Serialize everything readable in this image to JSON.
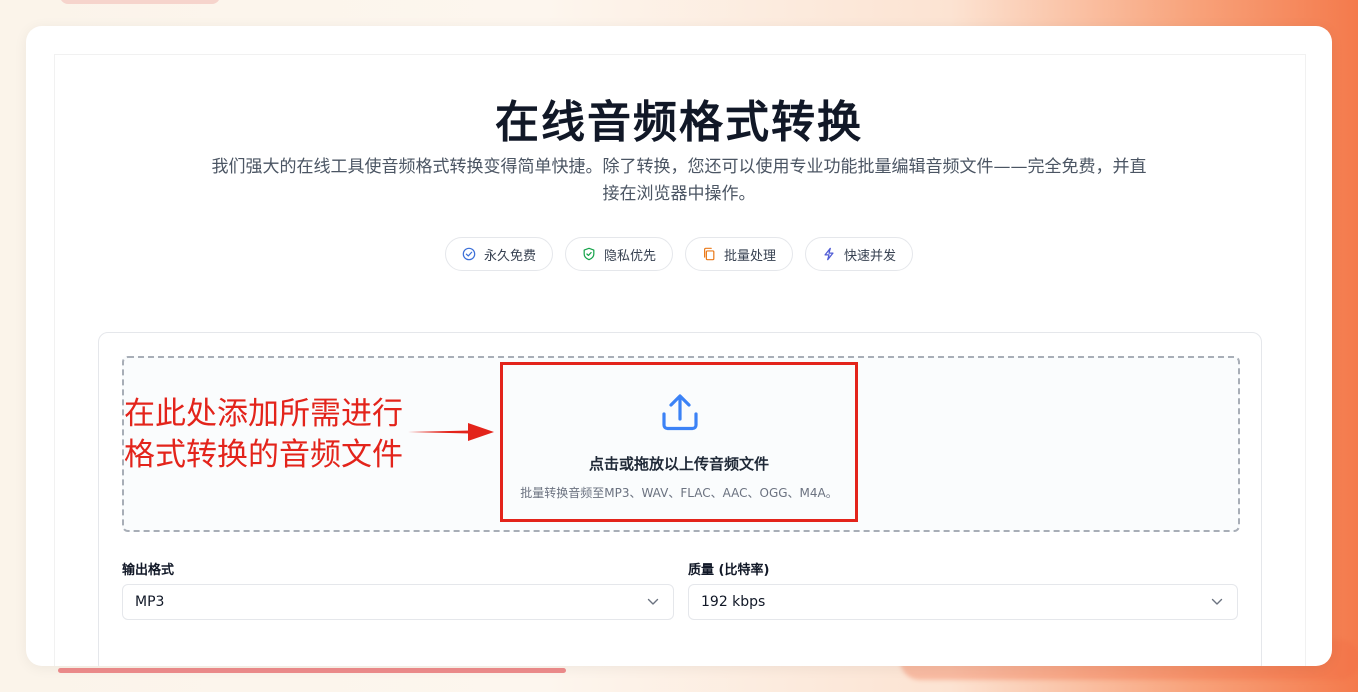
{
  "page": {
    "title": "在线音频格式转换",
    "subtitle": "我们强大的在线工具使音频格式转换变得简单快捷。除了转换，您还可以使用专业功能批量编辑音频文件——完全免费，并直接在浏览器中操作。"
  },
  "badges": [
    {
      "label": "永久免费",
      "icon": "check-circle-icon",
      "color": "#3b6fd8"
    },
    {
      "label": "隐私优先",
      "icon": "shield-check-icon",
      "color": "#16a34a"
    },
    {
      "label": "批量处理",
      "icon": "copy-files-icon",
      "color": "#ea7a1a"
    },
    {
      "label": "快速并发",
      "icon": "lightning-icon",
      "color": "#4f5bd5"
    }
  ],
  "upload": {
    "title": "点击或拖放以上传音频文件",
    "subtitle": "批量转换音频至MP3、WAV、FLAC、AAC、OGG、M4A。",
    "icon": "upload-icon",
    "icon_color": "#3b82f6"
  },
  "annotation": {
    "text_line1": "在此处添加所需进行",
    "text_line2": "格式转换的音频文件",
    "color": "#e3241b"
  },
  "settings": {
    "format_label": "输出格式",
    "format_value": "MP3",
    "quality_label": "质量 (比特率)",
    "quality_value": "192 kbps"
  }
}
